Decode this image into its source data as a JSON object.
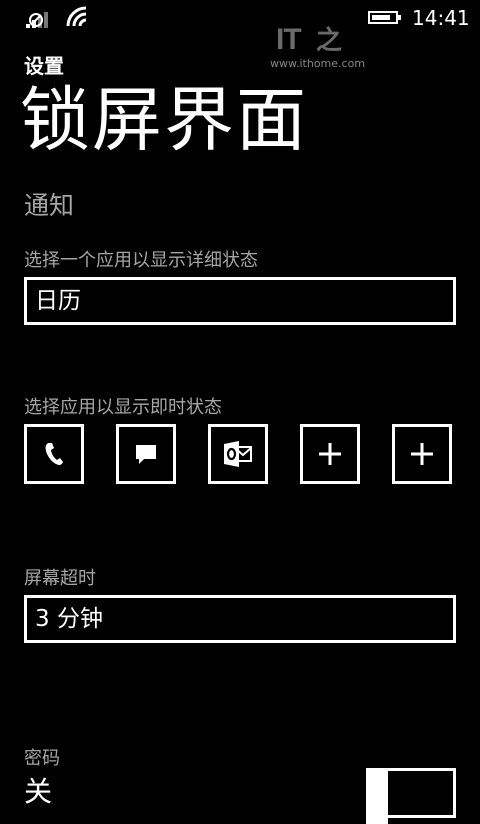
{
  "status_bar": {
    "time": "14:41",
    "icons": [
      "signal-icon",
      "wifi-icon",
      "battery-icon"
    ]
  },
  "watermark": {
    "logo": "IT之家",
    "url": "www.ithome.com"
  },
  "header": {
    "app_title": "设置",
    "page_title": "锁屏界面"
  },
  "notifications": {
    "section_title": "通知",
    "detailed_label": "选择一个应用以显示详细状态",
    "detailed_value": "日历",
    "quick_label": "选择应用以显示即时状态",
    "quick_tiles": [
      "phone-icon",
      "message-icon",
      "outlook-icon",
      "add-icon",
      "add-icon"
    ]
  },
  "screen_timeout": {
    "label": "屏幕超时",
    "value": "3 分钟"
  },
  "password": {
    "label": "密码",
    "value": "关",
    "enabled": false
  },
  "colors": {
    "background": "#000000",
    "foreground": "#ffffff",
    "secondary_text": "#a6a6a6"
  }
}
